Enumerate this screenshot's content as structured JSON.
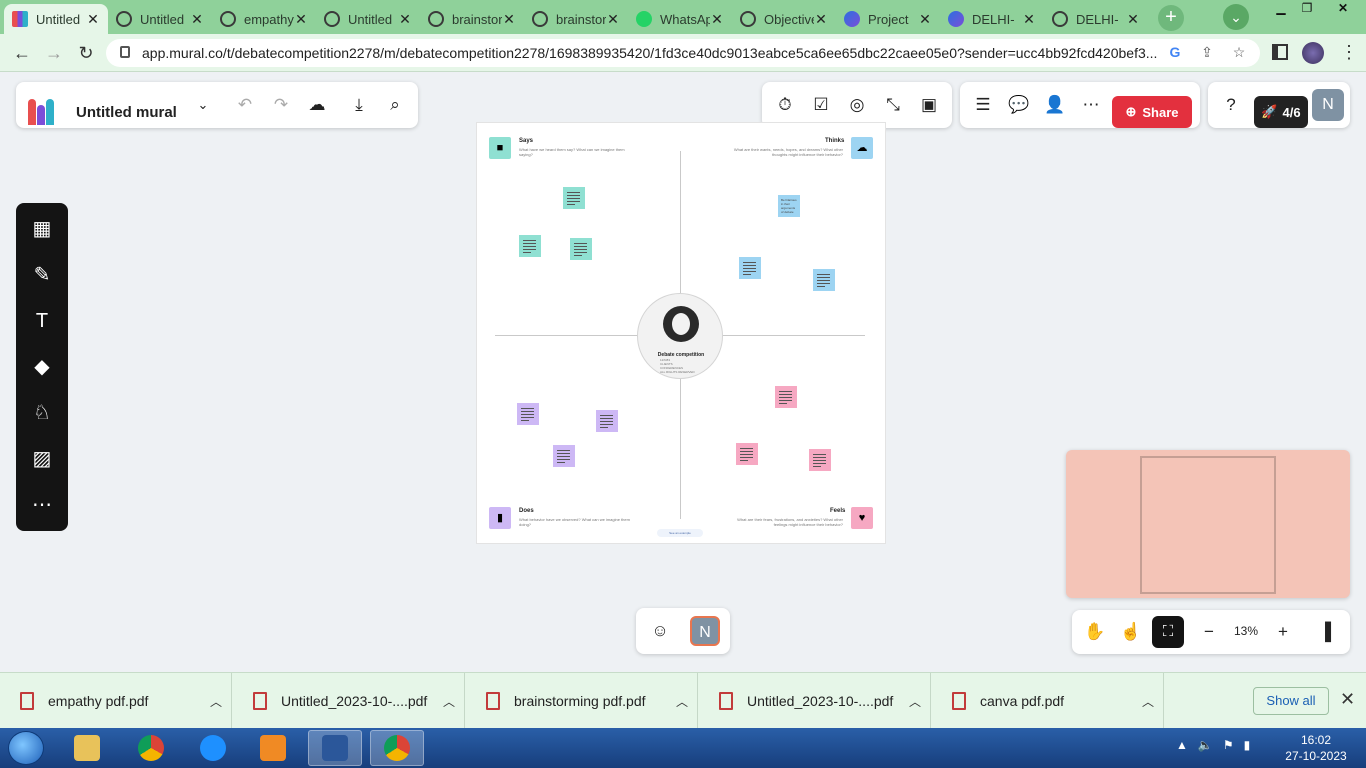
{
  "browser": {
    "tabs": [
      {
        "title": "Untitled",
        "icon": "mural-icon",
        "active": true
      },
      {
        "title": "Untitled",
        "icon": "globe-icon"
      },
      {
        "title": "empathy",
        "icon": "globe-icon"
      },
      {
        "title": "Untitled",
        "icon": "globe-icon"
      },
      {
        "title": "brainstorming",
        "icon": "globe-icon"
      },
      {
        "title": "brainstorming",
        "icon": "globe-icon"
      },
      {
        "title": "WhatsApp",
        "icon": "whatsapp-icon"
      },
      {
        "title": "Objectives",
        "icon": "globe-icon"
      },
      {
        "title": "Project",
        "icon": "canva-icon"
      },
      {
        "title": "DELHI-",
        "icon": "canva-icon"
      },
      {
        "title": "DELHI-",
        "icon": "globe-icon"
      }
    ],
    "url": "app.mural.co/t/debatecompetition2278/m/debatecompetition2278/1698389935420/1fd3ce40dc9013eabce5ca6ee65dbc22caee05e0?sender=ucc4bb92fcd420bef3..."
  },
  "mural": {
    "title": "Untitled mural",
    "share_label": "Share",
    "counter": "4/6",
    "avatar_initial": "N",
    "zoom": "13%",
    "board": {
      "center_title": "Debate competition",
      "center_sub": [
        "12/6/83",
        "CLIENTS",
        "CONFERENCES",
        "ALL RIGHTS RESERVED"
      ],
      "says_title": "Says",
      "says_sub": "What have we heard them say? What can we imagine them saying?",
      "thinks_title": "Thinks",
      "thinks_sub": "What are their wants, needs, hopes, and dreams? What other thoughts might influence their behavior?",
      "does_title": "Does",
      "does_sub": "What behavior have we observed? What can we imagine them doing?",
      "feels_title": "Feels",
      "feels_sub": "What are their fears, frustrations, and anxieties? What other feelings might influence their behavior?",
      "note_text": "Be hilarious in their arguments of debate",
      "example_label": "See an example"
    }
  },
  "downloads": [
    {
      "name": "empathy pdf.pdf"
    },
    {
      "name": "Untitled_2023-10-....pdf"
    },
    {
      "name": "brainstorming pdf.pdf"
    },
    {
      "name": "Untitled_2023-10-....pdf"
    },
    {
      "name": "canva pdf.pdf"
    }
  ],
  "show_all_label": "Show all",
  "taskbar": {
    "time": "16:02",
    "date": "27-10-2023"
  },
  "colors": {
    "says": "#8fe0d2",
    "thinks": "#9dd4f2",
    "does": "#cdb8f5",
    "feels": "#f6a8c2",
    "share": "#e3303e"
  }
}
